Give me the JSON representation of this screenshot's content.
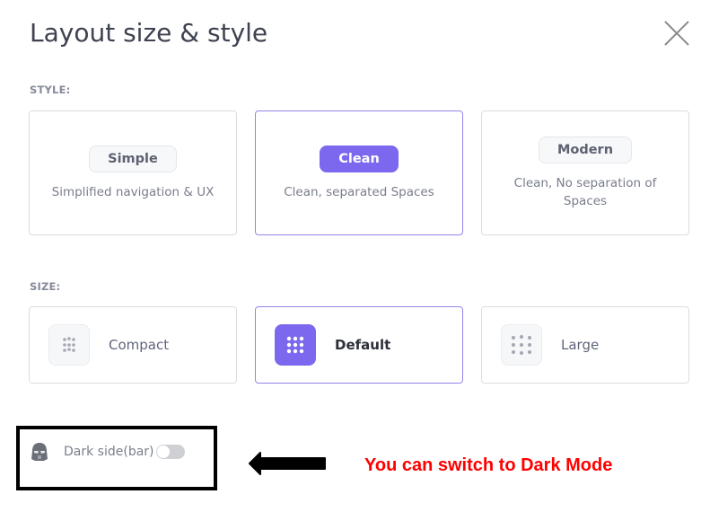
{
  "dialog": {
    "title": "Layout size & style",
    "close_icon": "close-x-icon"
  },
  "style_section": {
    "label": "STYLE:",
    "options": [
      {
        "name": "Simple",
        "description": "Simplified navigation & UX",
        "selected": false
      },
      {
        "name": "Clean",
        "description": "Clean, separated Spaces",
        "selected": true
      },
      {
        "name": "Modern",
        "description": "Clean, No separation of Spaces",
        "selected": false
      }
    ]
  },
  "size_section": {
    "label": "SIZE:",
    "options": [
      {
        "name": "Compact",
        "icon": "dots-grid-compact-icon",
        "selected": false
      },
      {
        "name": "Default",
        "icon": "dots-grid-default-icon",
        "selected": true
      },
      {
        "name": "Large",
        "icon": "dots-grid-large-icon",
        "selected": false
      }
    ]
  },
  "dark_sidebar": {
    "label": "Dark side(bar)",
    "icon": "darth-vader-helmet-icon",
    "enabled": false
  },
  "annotation": {
    "text": "You can switch to Dark Mode",
    "arrow_icon": "left-arrow-icon"
  },
  "colors": {
    "accent": "#7b68ee",
    "annotation": "#ff0000"
  }
}
